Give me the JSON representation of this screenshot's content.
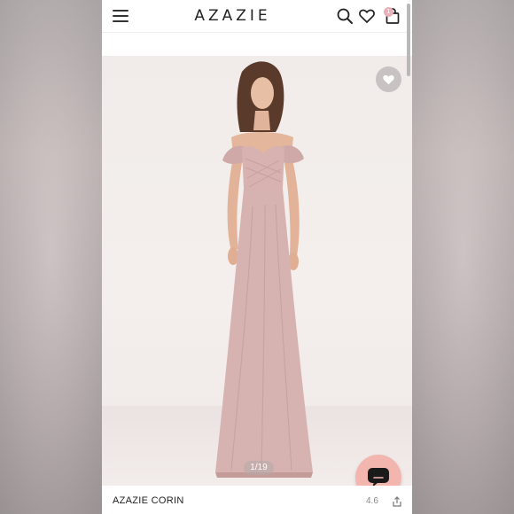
{
  "header": {
    "brand": "AZAZIE",
    "cart_count": "1"
  },
  "icons": {
    "menu": "hamburger-menu-icon",
    "search": "search-icon",
    "wishlist": "heart-icon",
    "cart": "shopping-bag-icon",
    "favorite": "heart-icon",
    "chat": "chat-bubble-icon",
    "share": "share-icon"
  },
  "gallery": {
    "pager": "1/19"
  },
  "product": {
    "name": "AZAZIE CORIN",
    "rating": "4.6"
  },
  "colors": {
    "dress": "#d6b3b1",
    "accent_chat": "#f2b6ae",
    "badge": "#e8b0b8"
  }
}
